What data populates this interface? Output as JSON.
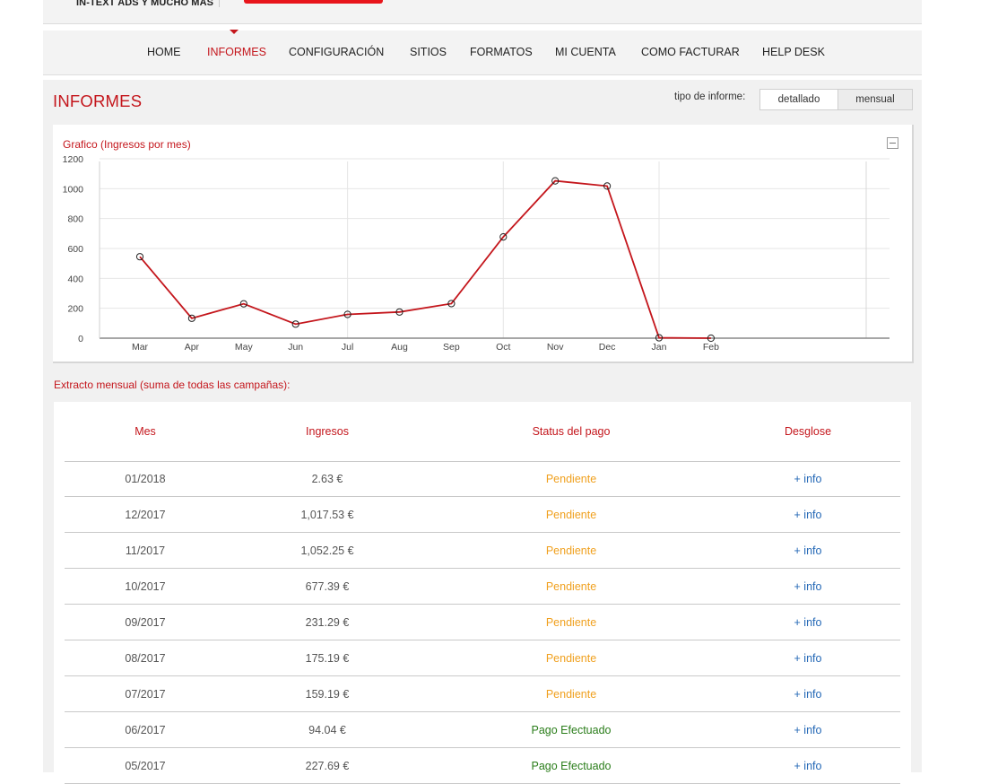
{
  "header": {
    "tagline": "IN-TEXT ADS Y MUCHO MÁS"
  },
  "nav": {
    "items": [
      {
        "label": "HOME",
        "active": false
      },
      {
        "label": "INFORMES",
        "active": true
      },
      {
        "label": "CONFIGURACIÓN",
        "active": false
      },
      {
        "label": "SITIOS",
        "active": false
      },
      {
        "label": "FORMATOS",
        "active": false
      },
      {
        "label": "MI CUENTA",
        "active": false
      },
      {
        "label": "COMO FACTURAR",
        "active": false
      },
      {
        "label": "HELP DESK",
        "active": false
      }
    ]
  },
  "page": {
    "title": "INFORMES",
    "report_type_label": "tipo de informe:",
    "report_types": [
      "detallado",
      "mensual"
    ],
    "selected_report_type": "mensual",
    "extract_title": "Extracto mensual (suma de todas las campañas):"
  },
  "chart_data": {
    "type": "line",
    "title": "Grafico (Ingresos por mes)",
    "categories": [
      "Mar",
      "Apr",
      "May",
      "Jun",
      "Jul",
      "Aug",
      "Sep",
      "Oct",
      "Nov",
      "Dec",
      "Jan",
      "Feb"
    ],
    "values": [
      545,
      133,
      230,
      94.04,
      159.19,
      175.19,
      231.29,
      677.39,
      1052.25,
      1017.53,
      2.63,
      0
    ],
    "y_ticks": [
      0,
      200,
      400,
      600,
      800,
      1000,
      1200
    ],
    "ylim": [
      0,
      1200
    ],
    "series_color": "#c4161c",
    "grid": true
  },
  "table": {
    "headers": [
      "Mes",
      "Ingresos",
      "Status del pago",
      "Desglose"
    ],
    "rows": [
      {
        "mes": "01/2018",
        "ingresos": "2.63 €",
        "status": "Pendiente",
        "desglose": "+ info"
      },
      {
        "mes": "12/2017",
        "ingresos": "1,017.53 €",
        "status": "Pendiente",
        "desglose": "+ info"
      },
      {
        "mes": "11/2017",
        "ingresos": "1,052.25 €",
        "status": "Pendiente",
        "desglose": "+ info"
      },
      {
        "mes": "10/2017",
        "ingresos": "677.39 €",
        "status": "Pendiente",
        "desglose": "+ info"
      },
      {
        "mes": "09/2017",
        "ingresos": "231.29 €",
        "status": "Pendiente",
        "desglose": "+ info"
      },
      {
        "mes": "08/2017",
        "ingresos": "175.19 €",
        "status": "Pendiente",
        "desglose": "+ info"
      },
      {
        "mes": "07/2017",
        "ingresos": "159.19 €",
        "status": "Pendiente",
        "desglose": "+ info"
      },
      {
        "mes": "06/2017",
        "ingresos": "94.04 €",
        "status": "Pago Efectuado",
        "desglose": "+ info"
      },
      {
        "mes": "05/2017",
        "ingresos": "227.69 €",
        "status": "Pago Efectuado",
        "desglose": "+ info"
      }
    ]
  }
}
